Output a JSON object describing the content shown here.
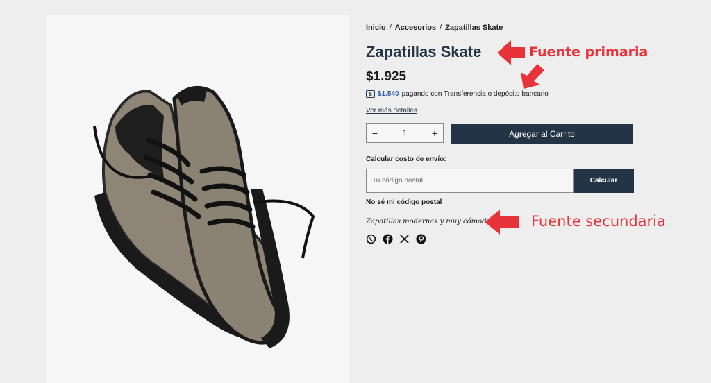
{
  "breadcrumb": {
    "items": [
      "Inicio",
      "Accesorios",
      "Zapatillas Skate"
    ],
    "separator": "/"
  },
  "product": {
    "title": "Zapatillas Skate",
    "price": "$1.925",
    "transfer_price": "$1.540",
    "transfer_text": "pagando con Transferencia o depósito bancario",
    "details_link": "Ver más detalles",
    "quantity": "1",
    "add_to_cart": "Agregar al Carrito",
    "description": "Zapatillas modernas y muy cómodas."
  },
  "shipping": {
    "label": "Calcular costo de envío:",
    "placeholder": "Tu código postal",
    "calc_button": "Calcular",
    "no_zip_link": "No sé mi código postal"
  },
  "share_icons": [
    "whatsapp-icon",
    "facebook-icon",
    "x-icon",
    "pinterest-icon"
  ],
  "annotations": {
    "primary": "Fuente primaria",
    "secondary": "Fuente secundaria"
  },
  "colors": {
    "primary": "#243447",
    "annotation": "#e8333a",
    "transfer_price": "#2b5aa8"
  }
}
